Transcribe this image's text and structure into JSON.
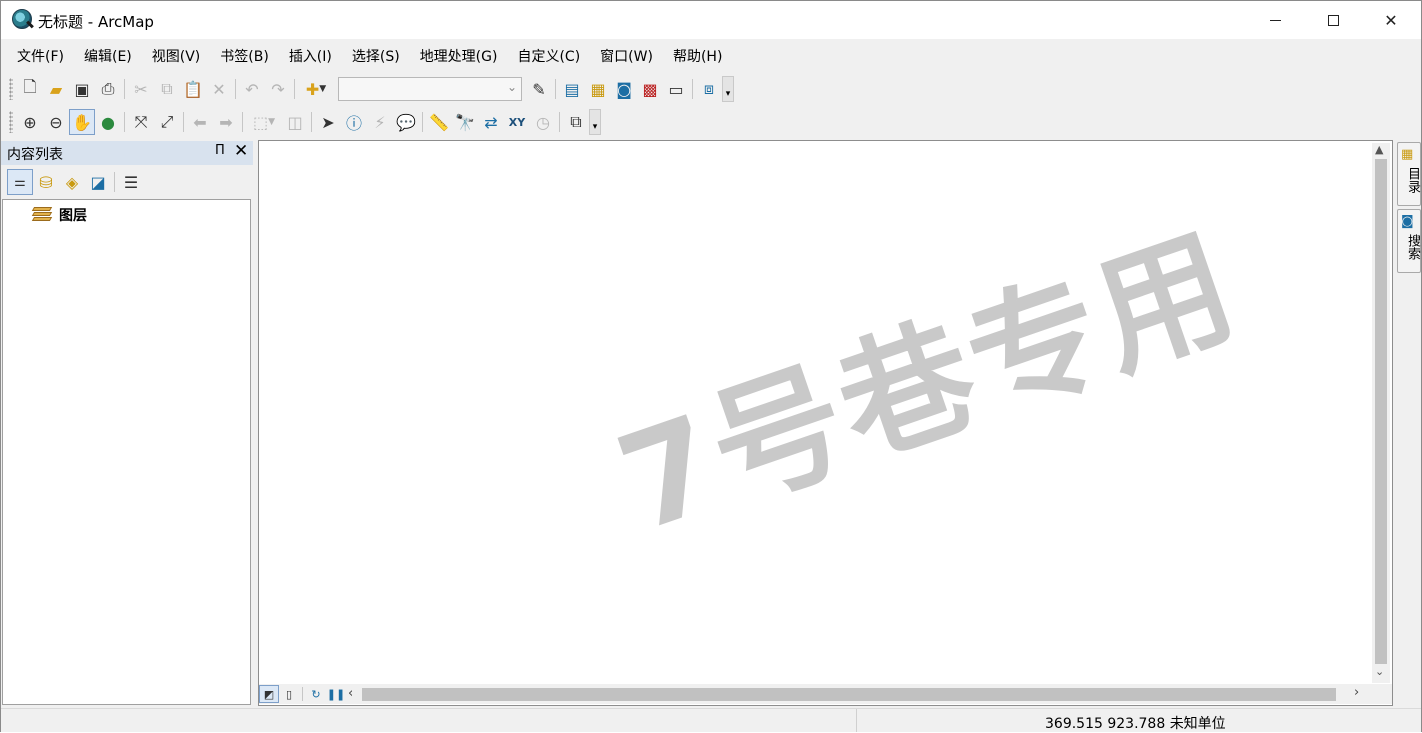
{
  "window": {
    "title": "无标题 - ArcMap"
  },
  "menu": {
    "items": [
      "文件(F)",
      "编辑(E)",
      "视图(V)",
      "书签(B)",
      "插入(I)",
      "选择(S)",
      "地理处理(G)",
      "自定义(C)",
      "窗口(W)",
      "帮助(H)"
    ]
  },
  "toolbar1": {
    "scale_combo_value": ""
  },
  "toc": {
    "title": "内容列表",
    "pin_label": "Π",
    "close_label": "✕",
    "layer_label": "图层"
  },
  "map": {
    "watermark": "7号巷专用"
  },
  "side_tabs": {
    "catalog": "目录",
    "search": "搜索"
  },
  "status": {
    "coordinates": "369.515  923.788 未知单位"
  },
  "icons": {
    "app": "arcmap-globe-icon",
    "accent": "#1c6ea4",
    "toc_header_bg": "#d8e2ee"
  }
}
